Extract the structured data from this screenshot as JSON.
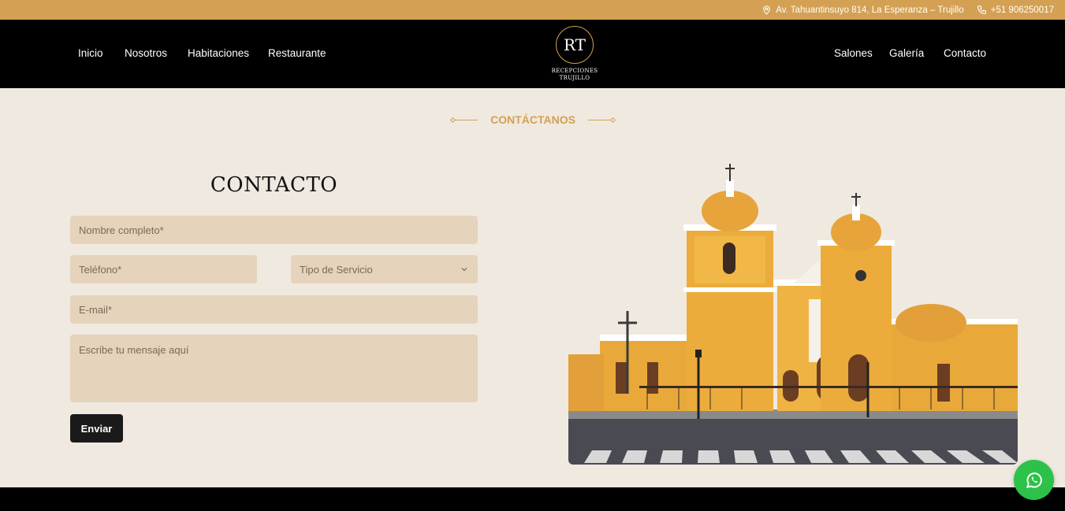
{
  "topbar": {
    "address": "Av. Tahuantinsuyo 814, La Esperanza – Trujillo",
    "phone": "+51 906250017"
  },
  "nav": {
    "left": [
      "Inicio",
      "Nosotros",
      "Habitaciones",
      "Restaurante"
    ],
    "right": [
      "Salones",
      "Galería",
      "Contacto"
    ],
    "logo_monogram": "RT",
    "logo_line1": "RECEPCIONES",
    "logo_line2": "TRUJILLO"
  },
  "section": {
    "eyebrow": "CONTÁCTANOS",
    "title": "CONTACTO"
  },
  "form": {
    "name_placeholder": "Nombre completo*",
    "phone_placeholder": "Teléfono*",
    "service_placeholder": "Tipo de Servicio",
    "email_placeholder": "E-mail*",
    "message_placeholder": "Escribe tu mensaje aquí",
    "submit_label": "Enviar"
  },
  "colors": {
    "accent": "#d4a053",
    "background": "#f0e9e0",
    "field": "#e5d3bb",
    "whatsapp": "#2cc24a"
  },
  "icons": [
    "location-icon",
    "phone-icon",
    "chevron-down-icon",
    "whatsapp-icon"
  ]
}
